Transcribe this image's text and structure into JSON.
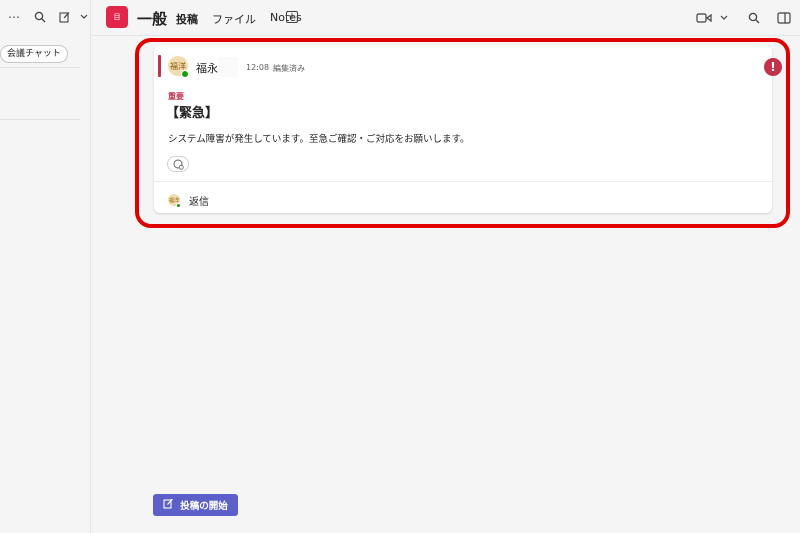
{
  "sidebar": {
    "chip_label": "会議チャット"
  },
  "header": {
    "team_tile_text": "目",
    "channel_name": "一般",
    "tabs": [
      {
        "label": "投稿",
        "active": true
      },
      {
        "label": "ファイル",
        "active": false
      },
      {
        "label": "Notes",
        "active": false
      }
    ]
  },
  "message": {
    "avatar_initials": "福洋",
    "author": "福永",
    "timestamp": "12:08",
    "edited_label": "編集済み",
    "importance_label": "重要",
    "subject": "【緊急】",
    "body": "システム障害が発生しています。至急ご確認・ご対応をお願いします。",
    "reply_label": "返信",
    "accent_color": "#c4314b"
  },
  "compose": {
    "new_post_label": "投稿の開始",
    "button_color": "#5b5fc7"
  },
  "highlight_color": "#e00000"
}
